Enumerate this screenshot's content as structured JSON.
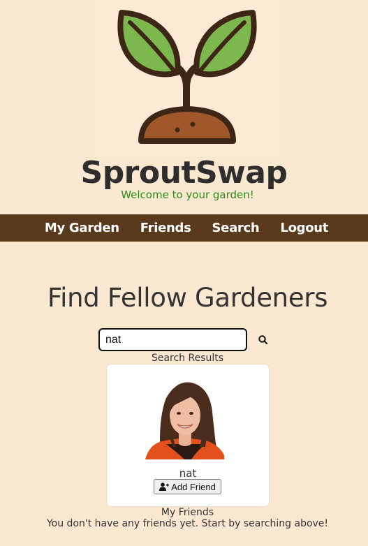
{
  "brand": {
    "name": "SproutSwap",
    "tagline": "Welcome to your garden!"
  },
  "nav": {
    "items": [
      {
        "label": "My Garden"
      },
      {
        "label": "Friends"
      },
      {
        "label": "Search"
      },
      {
        "label": "Logout"
      }
    ]
  },
  "page": {
    "title": "Find Fellow Gardeners"
  },
  "search": {
    "value": "nat",
    "icon": "search-icon",
    "results_label": "Search Results"
  },
  "results": [
    {
      "name": "nat",
      "button_label": "Add Friend",
      "button_icon": "user-plus-icon"
    }
  ],
  "friends": {
    "label": "My Friends",
    "empty_message": "You don't have any friends yet. Start by searching above!"
  },
  "colors": {
    "background": "#fbe8d1",
    "nav_bar": "#5a3a1c",
    "tagline": "#2d8a1e",
    "leaf": "#7db84f",
    "soil": "#a0572a",
    "outline": "#3d2616"
  }
}
